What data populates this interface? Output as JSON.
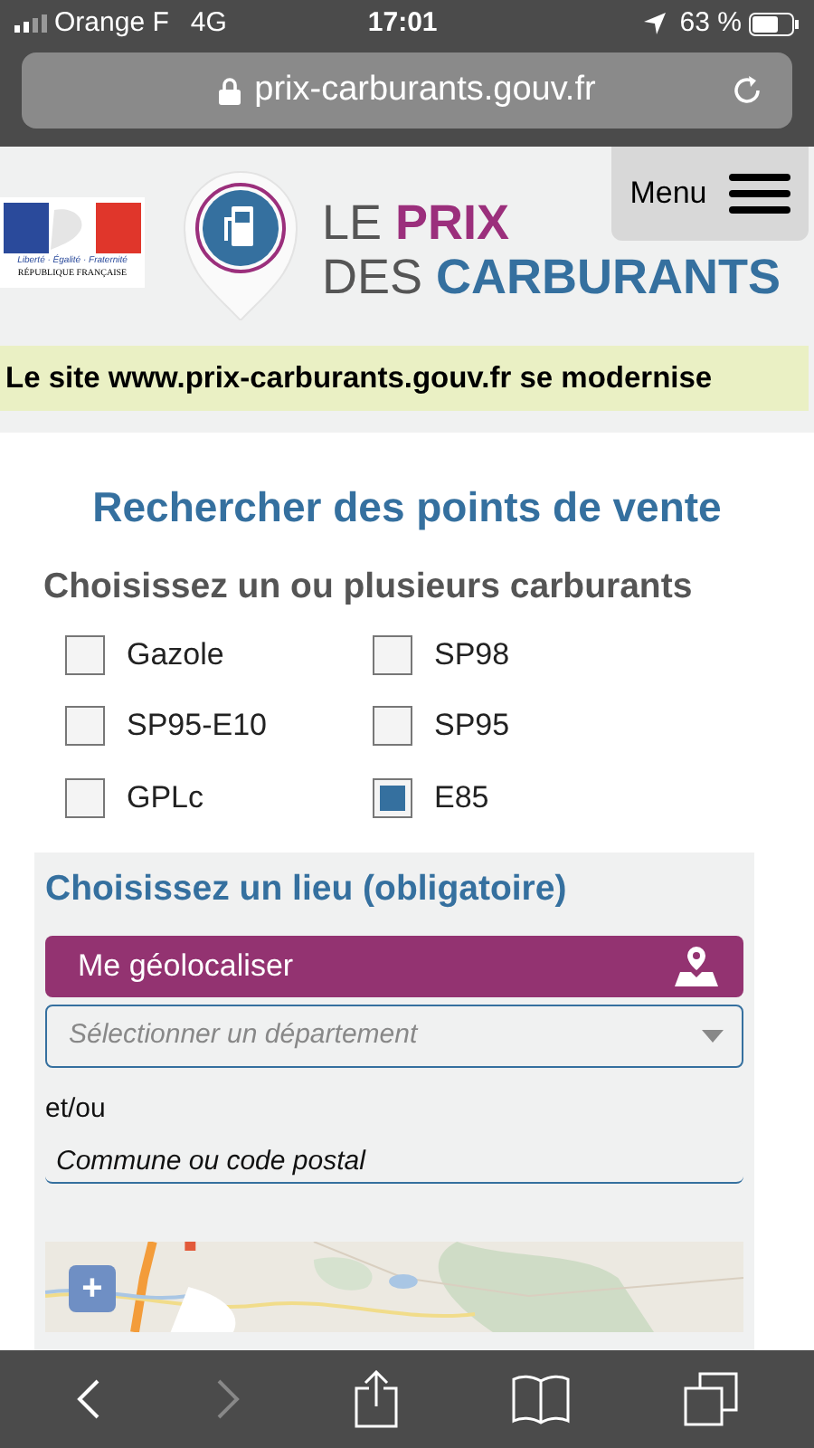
{
  "status_bar": {
    "carrier": "Orange F",
    "network": "4G",
    "time": "17:01",
    "battery": "63 %"
  },
  "address_bar": {
    "url": "prix-carburants.gouv.fr"
  },
  "header": {
    "gov_motto": "Liberté · Égalité · Fraternité",
    "gov_name": "RÉPUBLIQUE FRANÇAISE",
    "logo_line_1a": "LE",
    "logo_line_1b": "PRIX",
    "logo_line_2a": "DES",
    "logo_line_2b": "CARBURANTS",
    "menu": "Menu"
  },
  "banner": "Le site www.prix-carburants.gouv.fr se modernise",
  "search": {
    "title": "Rechercher des points de vente",
    "fuels_title": "Choisissez un ou plusieurs carburants",
    "fuels": [
      {
        "label": "Gazole",
        "checked": false
      },
      {
        "label": "SP98",
        "checked": false
      },
      {
        "label": "SP95-E10",
        "checked": false
      },
      {
        "label": "SP95",
        "checked": false
      },
      {
        "label": "GPLc",
        "checked": false
      },
      {
        "label": "E85",
        "checked": true
      }
    ],
    "place_title": "Choisissez un lieu (obligatoire)",
    "geolocate": "Me géolocaliser",
    "department": {
      "placeholder": "Sélectionner un département"
    },
    "and_or": "et/ou",
    "commune": {
      "placeholder": "Commune ou code postal"
    },
    "zoom_in": "+"
  }
}
